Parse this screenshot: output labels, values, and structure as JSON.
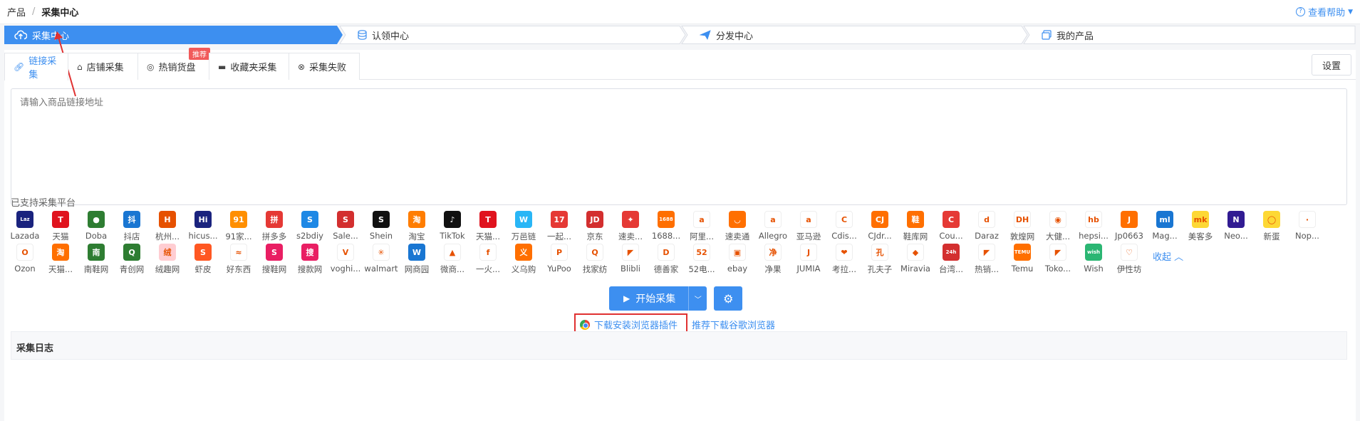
{
  "breadcrumb": {
    "root": "产品",
    "current": "采集中心"
  },
  "help_label": "查看帮助",
  "steps": [
    {
      "label": "采集中心",
      "icon": "cloud-upload-icon"
    },
    {
      "label": "认领中心",
      "icon": "database-icon"
    },
    {
      "label": "分发中心",
      "icon": "paper-plane-icon"
    },
    {
      "label": "我的产品",
      "icon": "stack-icon"
    }
  ],
  "tabs": [
    {
      "label": "链接采集",
      "icon": "link-icon"
    },
    {
      "label": "店铺采集",
      "icon": "home-icon"
    },
    {
      "label": "热销货盘",
      "icon": "target-icon",
      "badge": "推荐"
    },
    {
      "label": "收藏夹采集",
      "icon": "folder-icon"
    },
    {
      "label": "采集失败",
      "icon": "close-circle-icon"
    }
  ],
  "settings_label": "设置",
  "url_placeholder": "请输入商品链接地址",
  "platforms_title": "已支持采集平台",
  "platforms_row1": [
    {
      "name": "Lazada",
      "color": "#1a237e",
      "glyph": "Laz"
    },
    {
      "name": "天猫",
      "color": "#e0131e",
      "glyph": "T"
    },
    {
      "name": "Doba",
      "color": "#2e7d32",
      "glyph": "●"
    },
    {
      "name": "抖店",
      "color": "#1976d2",
      "glyph": "抖"
    },
    {
      "name": "杭州...",
      "color": "#e65100",
      "glyph": "H"
    },
    {
      "name": "hicus...",
      "color": "#1a237e",
      "glyph": "Hi"
    },
    {
      "name": "91家...",
      "color": "#ff8f00",
      "glyph": "91"
    },
    {
      "name": "拼多多",
      "color": "#e53935",
      "glyph": "拼"
    },
    {
      "name": "s2bdiy",
      "color": "#1e88e5",
      "glyph": "S"
    },
    {
      "name": "Sale...",
      "color": "#d32f2f",
      "glyph": "S"
    },
    {
      "name": "Shein",
      "color": "#111111",
      "glyph": "S"
    },
    {
      "name": "淘宝",
      "color": "#ff7d00",
      "glyph": "淘"
    },
    {
      "name": "TikTok",
      "color": "#111111",
      "glyph": "♪"
    },
    {
      "name": "天猫...",
      "color": "#e0131e",
      "glyph": "T"
    },
    {
      "name": "万邑链",
      "color": "#29b6f6",
      "glyph": "W"
    },
    {
      "name": "一起...",
      "color": "#e53935",
      "glyph": "17"
    },
    {
      "name": "京东",
      "color": "#d32f2f",
      "glyph": "JD"
    },
    {
      "name": "速卖...",
      "color": "#e53935",
      "glyph": "✦"
    },
    {
      "name": "1688...",
      "color": "#ff6f00",
      "glyph": "1688"
    },
    {
      "name": "阿里...",
      "color": "#ffffff",
      "glyph": "a"
    },
    {
      "name": "速卖通",
      "color": "#ff6f00",
      "glyph": "◡"
    },
    {
      "name": "Allegro",
      "color": "#ffffff",
      "glyph": "a"
    },
    {
      "name": "亚马逊",
      "color": "#ffffff",
      "glyph": "a"
    },
    {
      "name": "Cdis...",
      "color": "#ffffff",
      "glyph": "C"
    },
    {
      "name": "CJdr...",
      "color": "#ff6f00",
      "glyph": "CJ"
    },
    {
      "name": "鞋库网",
      "color": "#ff6f00",
      "glyph": "鞋"
    },
    {
      "name": "Cou...",
      "color": "#e53935",
      "glyph": "C"
    },
    {
      "name": "Daraz",
      "color": "#ffffff",
      "glyph": "d"
    },
    {
      "name": "敦煌网",
      "color": "#ffffff",
      "glyph": "DH"
    },
    {
      "name": "大健...",
      "color": "#ffffff",
      "glyph": "◉"
    },
    {
      "name": "hepsi...",
      "color": "#ffffff",
      "glyph": "hb"
    },
    {
      "name": "Jp0663",
      "color": "#ff6f00",
      "glyph": "J"
    },
    {
      "name": "Mag...",
      "color": "#1976d2",
      "glyph": "ml"
    },
    {
      "name": "美客多",
      "color": "#fdd835",
      "glyph": "mk"
    },
    {
      "name": "Neo...",
      "color": "#311b92",
      "glyph": "N"
    },
    {
      "name": "新蛋",
      "color": "#fdd835",
      "glyph": "◯"
    },
    {
      "name": "Nop...",
      "color": "#ffffff",
      "glyph": "·"
    }
  ],
  "platforms_row2": [
    {
      "name": "Ozon",
      "color": "#ffffff",
      "glyph": "O"
    },
    {
      "name": "天猫...",
      "color": "#ff6f00",
      "glyph": "淘"
    },
    {
      "name": "南鞋网",
      "color": "#2e7d32",
      "glyph": "南"
    },
    {
      "name": "青创网",
      "color": "#2e7d32",
      "glyph": "Q"
    },
    {
      "name": "绒趣网",
      "color": "#ffcdd2",
      "glyph": "绒"
    },
    {
      "name": "虾皮",
      "color": "#ff5722",
      "glyph": "S"
    },
    {
      "name": "好东西",
      "color": "#ffffff",
      "glyph": "≈"
    },
    {
      "name": "搜鞋网",
      "color": "#e91e63",
      "glyph": "S"
    },
    {
      "name": "搜款网",
      "color": "#e91e63",
      "glyph": "搜"
    },
    {
      "name": "voghi...",
      "color": "#ffffff",
      "glyph": "V"
    },
    {
      "name": "walmart",
      "color": "#ffffff",
      "glyph": "✳"
    },
    {
      "name": "网商园",
      "color": "#1976d2",
      "glyph": "W"
    },
    {
      "name": "微商...",
      "color": "#ffffff",
      "glyph": "▲"
    },
    {
      "name": "一火...",
      "color": "#ffffff",
      "glyph": "f"
    },
    {
      "name": "义乌购",
      "color": "#ff6f00",
      "glyph": "义"
    },
    {
      "name": "YuPoo",
      "color": "#ffffff",
      "glyph": "P"
    },
    {
      "name": "找家纺",
      "color": "#ffffff",
      "glyph": "Q"
    },
    {
      "name": "Blibli",
      "color": "#ffffff",
      "glyph": "◤"
    },
    {
      "name": "德善家",
      "color": "#ffffff",
      "glyph": "D"
    },
    {
      "name": "52电...",
      "color": "#ffffff",
      "glyph": "52"
    },
    {
      "name": "ebay",
      "color": "#ffffff",
      "glyph": "▣"
    },
    {
      "name": "净果",
      "color": "#ffffff",
      "glyph": "净"
    },
    {
      "name": "JUMIA",
      "color": "#ffffff",
      "glyph": "J"
    },
    {
      "name": "考拉...",
      "color": "#ffffff",
      "glyph": "❤"
    },
    {
      "name": "孔夫子",
      "color": "#ffffff",
      "glyph": "孔"
    },
    {
      "name": "Miravia",
      "color": "#ffffff",
      "glyph": "◆"
    },
    {
      "name": "台湾...",
      "color": "#d32f2f",
      "glyph": "24h"
    },
    {
      "name": "热销...",
      "color": "#ffffff",
      "glyph": "◤"
    },
    {
      "name": "Temu",
      "color": "#ff6f00",
      "glyph": "TEMU"
    },
    {
      "name": "Toko...",
      "color": "#ffffff",
      "glyph": "◤"
    },
    {
      "name": "Wish",
      "color": "#2bb673",
      "glyph": "wish"
    },
    {
      "name": "伊性坊",
      "color": "#ffffff",
      "glyph": "♡"
    }
  ],
  "collapse_label": "收起",
  "start_label": "开始采集",
  "download_plugin_label": "下载安装浏览器插件",
  "download_chrome_label": "推荐下载谷歌浏览器",
  "log_title": "采集日志",
  "accent_color": "#3d8ff0",
  "highlight_color": "#e03131"
}
